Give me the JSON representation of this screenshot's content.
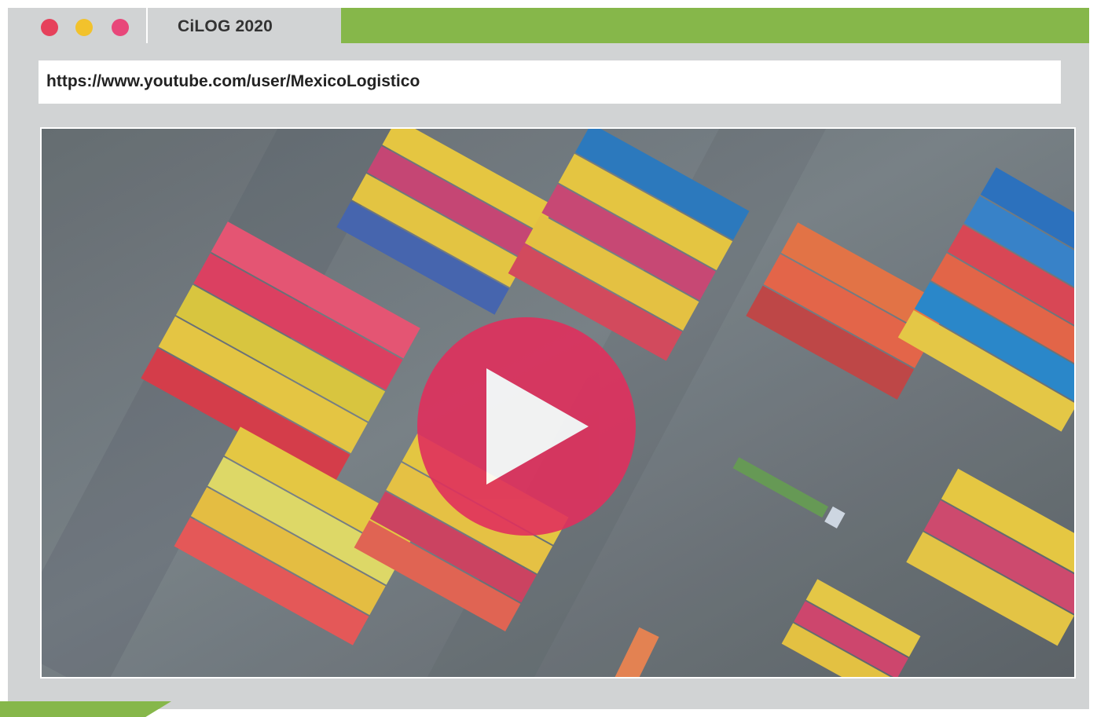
{
  "window": {
    "tab_title": "CiLOG 2020",
    "address_url": "https://www.youtube.com/user/MexicoLogistico"
  },
  "colors": {
    "accent_green": "#86b74a",
    "traffic_red": "#e6415b",
    "traffic_yellow": "#f2c22c",
    "traffic_pink": "#e8477a",
    "play_button": "#e0305d"
  },
  "icons": {
    "window_controls": [
      "red-dot-icon",
      "yellow-dot-icon",
      "pink-dot-icon"
    ],
    "video_overlay": "play-icon"
  }
}
